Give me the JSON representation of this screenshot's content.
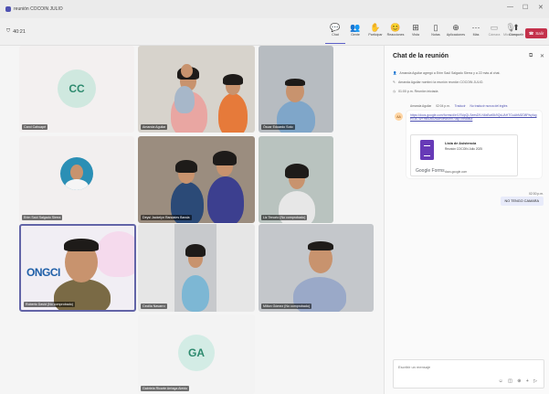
{
  "window": {
    "title": "reunión COCOIN JULIO",
    "controls": [
      "—",
      "☐",
      "✕"
    ]
  },
  "toolbar": {
    "timer": "40:21",
    "buttons": [
      {
        "label": "Chat",
        "icon": "💬",
        "state": "active"
      },
      {
        "label": "Gente",
        "icon": "👥",
        "badge": "11"
      },
      {
        "label": "Participar",
        "icon": "✋"
      },
      {
        "label": "Reacciones",
        "icon": "😊"
      },
      {
        "label": "Vista",
        "icon": "⊞"
      },
      {
        "label": "Notas",
        "icon": "▯"
      },
      {
        "label": "Aplicaciones",
        "icon": "⊕"
      },
      {
        "label": "Más",
        "icon": "⋯"
      },
      {
        "label": "Cámara",
        "icon": "▭",
        "state": "dim"
      },
      {
        "label": "Micrófono",
        "icon": "🎙",
        "state": "dim"
      },
      {
        "label": "Compartir",
        "icon": "⬆"
      }
    ],
    "leave_label": "Salir"
  },
  "participants": [
    {
      "name": "Carol Cahuapé",
      "initials": "CC",
      "avatar_color": "#2d8a6e",
      "avatar_bg": "#cfe8df"
    },
    {
      "name": "Amanda Aguilar"
    },
    {
      "name": "Óscar Eduardo Soto"
    },
    {
      "name": "Erim Saúl Salgado Sierra"
    },
    {
      "name": "Deysi Jackelyn Randales Banda"
    },
    {
      "name": "Liz Tenorio (No comprobado)"
    },
    {
      "name": "Roberto David (No comprobado)",
      "banner": "ONGCI"
    },
    {
      "name": "Cecilia Navarro"
    },
    {
      "name": "Milton Gómez (No comprobado)"
    },
    {
      "name": "Gabriela Ricarte Arriaga Aleido",
      "initials": "GA",
      "avatar_color": "#2d8a6e",
      "avatar_bg": "#d3ece5"
    }
  ],
  "chat": {
    "title": "Chat de la reunión",
    "events": [
      {
        "icon": "👤",
        "text": "Amanda Aguilar agregó a Erim Saúl Salgado Sierra y a 22 más al chat."
      },
      {
        "icon": "✎",
        "text": "Amanda Aguilar nombró la reunión reunión COCOIN JULIO."
      },
      {
        "icon": "◷",
        "text": "01:00 p.m.   Reunión iniciada"
      }
    ],
    "message": {
      "author": "Amanda Aguilar",
      "time": "02:04 p.m.",
      "flags": [
        "Traducir",
        "No traducir nunca del inglés"
      ],
      "initials": "AA",
      "link": "https://docs.google.com/forms/d/e/1FAIpQLSeesD9-N6xBvd5k9QsUAHTGuAbMlZ08FfsyfugeX3E-WFmBOtkUww/viewform?usp=headsuf",
      "card": {
        "title": "Lista de Asistencia",
        "subtitle": "Reunión COCOIN Julio 2025",
        "brand": "Google Forms",
        "url": "docs.google.com"
      }
    },
    "my_message": {
      "time": "02:30 p.m.",
      "text": "NO TENGO CAMARA"
    },
    "compose_placeholder": "Escribir un mensaje",
    "compose_icons": "☺ ◫ ⊕ + ▷"
  }
}
